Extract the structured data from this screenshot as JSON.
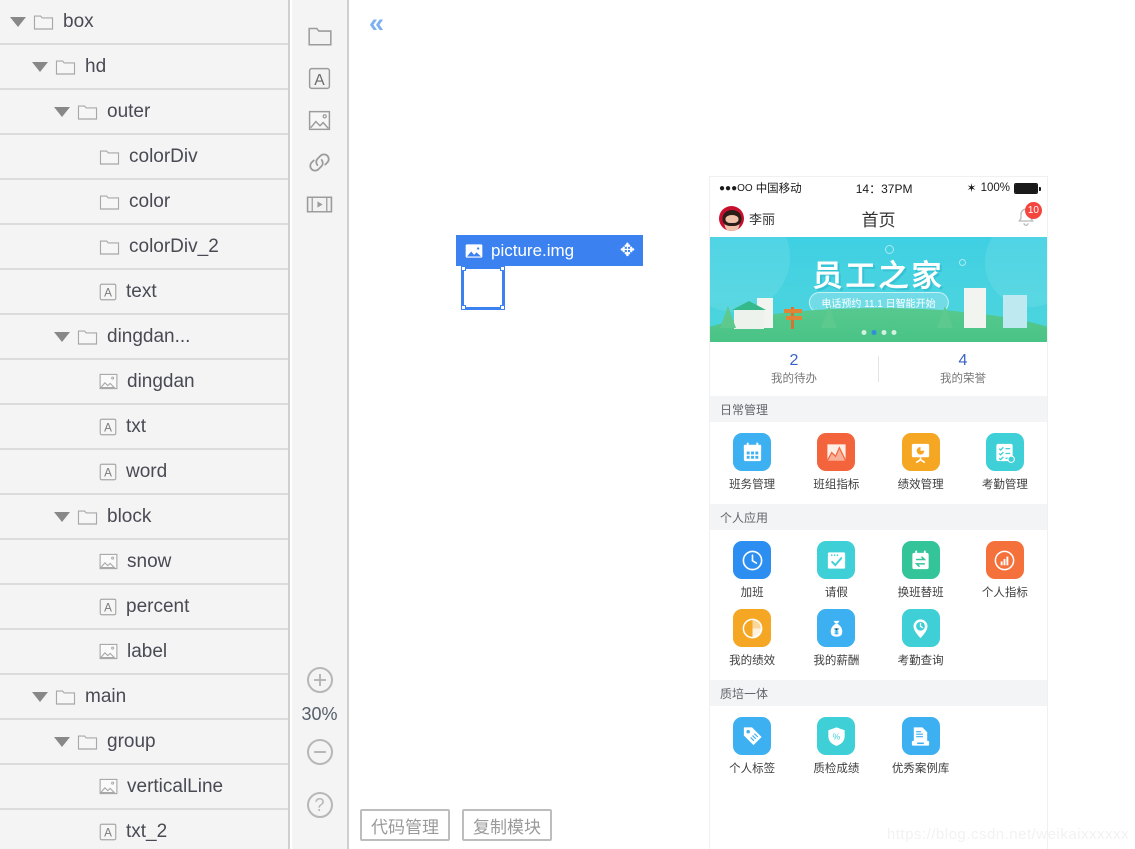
{
  "tree": {
    "items": [
      {
        "label": "box",
        "indent": 0,
        "icon": "folder-icon",
        "caret": true
      },
      {
        "label": "hd",
        "indent": 1,
        "icon": "folder-icon",
        "caret": true
      },
      {
        "label": "outer",
        "indent": 2,
        "icon": "folder-icon",
        "caret": true
      },
      {
        "label": "colorDiv",
        "indent": 3,
        "icon": "folder-icon",
        "caret": false
      },
      {
        "label": "color",
        "indent": 3,
        "icon": "folder-icon",
        "caret": false
      },
      {
        "label": "colorDiv_2",
        "indent": 3,
        "icon": "folder-icon",
        "caret": false
      },
      {
        "label": "text",
        "indent": 3,
        "icon": "text-icon",
        "caret": false
      },
      {
        "label": "dingdan...",
        "indent": 2,
        "icon": "folder-icon",
        "caret": true
      },
      {
        "label": "dingdan",
        "indent": 3,
        "icon": "image-icon",
        "caret": false
      },
      {
        "label": "txt",
        "indent": 3,
        "icon": "text-icon",
        "caret": false
      },
      {
        "label": "word",
        "indent": 3,
        "icon": "text-icon",
        "caret": false
      },
      {
        "label": "block",
        "indent": 2,
        "icon": "folder-icon",
        "caret": true
      },
      {
        "label": "snow",
        "indent": 3,
        "icon": "image-icon",
        "caret": false
      },
      {
        "label": "percent",
        "indent": 3,
        "icon": "text-icon",
        "caret": false
      },
      {
        "label": "label",
        "indent": 3,
        "icon": "image-icon",
        "caret": false
      },
      {
        "label": "main",
        "indent": 1,
        "icon": "folder-icon",
        "caret": true
      },
      {
        "label": "group",
        "indent": 2,
        "icon": "folder-icon",
        "caret": true
      },
      {
        "label": "verticalLine",
        "indent": 3,
        "icon": "image-icon",
        "caret": false
      },
      {
        "label": "txt_2",
        "indent": 3,
        "icon": "text-icon",
        "caret": false
      }
    ]
  },
  "toolstrip": {
    "tools": [
      {
        "name": "folder-tool-icon"
      },
      {
        "name": "text-tool-icon"
      },
      {
        "name": "image-tool-icon"
      },
      {
        "name": "link-tool-icon"
      },
      {
        "name": "video-tool-icon"
      }
    ],
    "zoom_level": "30%",
    "zoom_in_label": "+",
    "zoom_out_label": "−",
    "help_label": "?"
  },
  "canvas": {
    "collapse_icon": "«",
    "watermark": "https://blog.csdn.net/weikaixxxxxx",
    "buttons": [
      {
        "label": "代码管理",
        "name": "code-manage-button"
      },
      {
        "label": "复制模块",
        "name": "copy-module-button"
      }
    ]
  },
  "selection": {
    "label": "picture.img",
    "icon": "image-icon",
    "move_icon": "✥"
  },
  "phone": {
    "status_bar": {
      "signal": "●●●OO",
      "carrier": "中国移动",
      "time": "14：37PM",
      "bluetooth": "✶",
      "battery_text": "100%"
    },
    "nav": {
      "user_name": "李丽",
      "title": "首页",
      "bell_badge": "10"
    },
    "banner": {
      "title": "员工之家",
      "subtitle": "电话预约 11.1 日智能开始",
      "dot_count": 4,
      "active_dot": 1
    },
    "stats": [
      {
        "num": "2",
        "cap": "我的待办"
      },
      {
        "num": "4",
        "cap": "我的荣誉"
      }
    ],
    "sections": [
      {
        "title": "日常管理",
        "items": [
          {
            "cap": "班务管理",
            "icon": "calendar-icon",
            "color": "#3cb0f0"
          },
          {
            "cap": "班组指标",
            "icon": "chart-icon",
            "color": "#f4643c"
          },
          {
            "cap": "绩效管理",
            "icon": "easel-icon",
            "color": "#f5a623"
          },
          {
            "cap": "考勤管理",
            "icon": "checklist-icon",
            "color": "#3ed0d6"
          }
        ]
      },
      {
        "title": "个人应用",
        "items": [
          {
            "cap": "加班",
            "icon": "clock-icon",
            "color": "#2b8ef0"
          },
          {
            "cap": "请假",
            "icon": "check-icon",
            "color": "#3ed0d6"
          },
          {
            "cap": "换班替班",
            "icon": "swap-icon",
            "color": "#34c49a"
          },
          {
            "cap": "个人指标",
            "icon": "bar-icon",
            "color": "#f5713c"
          },
          {
            "cap": "我的绩效",
            "icon": "pie-icon",
            "color": "#f5a623"
          },
          {
            "cap": "我的薪酬",
            "icon": "money-icon",
            "color": "#3cb0f0"
          },
          {
            "cap": "考勤查询",
            "icon": "pin-clock-icon",
            "color": "#3ed0d6"
          }
        ]
      },
      {
        "title": "质培一体",
        "items": [
          {
            "cap": "个人标签",
            "icon": "tag-icon",
            "color": "#3cb0f0"
          },
          {
            "cap": "质检成绩",
            "icon": "shield-icon",
            "color": "#3ed0d6"
          },
          {
            "cap": "优秀案例库",
            "icon": "file-icon",
            "color": "#3cb0f0"
          }
        ]
      }
    ]
  },
  "colors": {
    "accent": "#3b82f0",
    "panel_bg": "#f4f4f4",
    "banner": "#49d3e0"
  }
}
